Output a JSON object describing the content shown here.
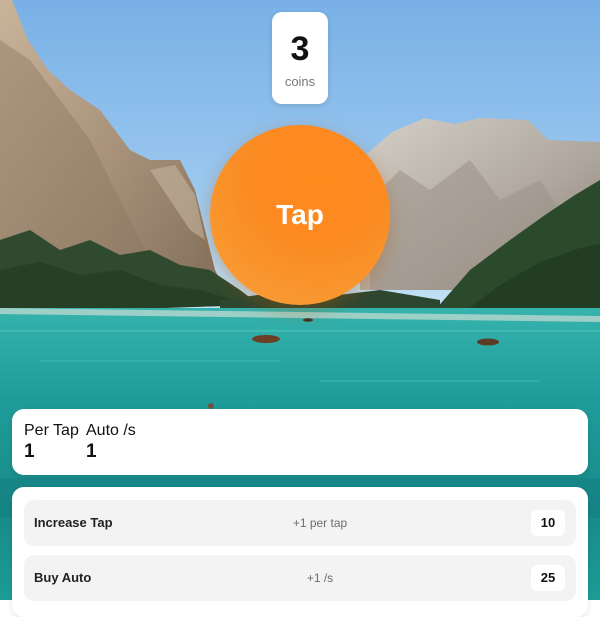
{
  "counter": {
    "value": "3",
    "unit": "coins"
  },
  "tap_button": {
    "label": "Tap",
    "color": "#fb8a22"
  },
  "stats": [
    {
      "label": "Per Tap",
      "value": "1"
    },
    {
      "label": "Auto /s",
      "value": "1"
    }
  ],
  "shop": {
    "items": [
      {
        "name": "Increase Tap",
        "description": "+1 per tap",
        "cost": "10"
      },
      {
        "name": "Buy Auto",
        "description": "+1 /s",
        "cost": "25"
      }
    ]
  }
}
